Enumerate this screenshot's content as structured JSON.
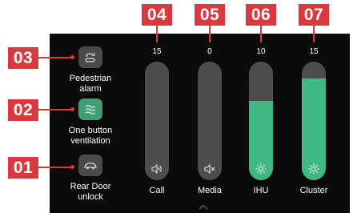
{
  "controls": [
    {
      "number": "03",
      "label_line1": "Pedestrian",
      "label_line2": "alarm",
      "icon": "pedestrian-alarm-icon",
      "active": false
    },
    {
      "number": "02",
      "label_line1": "One button",
      "label_line2": "ventilation",
      "icon": "ventilation-icon",
      "active": true
    },
    {
      "number": "01",
      "label_line1": "Rear Door",
      "label_line2": "unlock",
      "icon": "rear-door-car-icon",
      "active": false
    }
  ],
  "sliders": [
    {
      "number": "04",
      "value": "15",
      "label": "Call",
      "icon": "speaker-icon",
      "level": 0
    },
    {
      "number": "05",
      "value": "0",
      "label": "Media",
      "icon": "speaker-muted-icon",
      "level": 0
    },
    {
      "number": "06",
      "value": "10",
      "label": "IHU",
      "icon": "brightness-icon",
      "level": 0.67
    },
    {
      "number": "07",
      "value": "15",
      "label": "Cluster",
      "icon": "brightness-icon",
      "level": 0.86
    }
  ],
  "colors": {
    "callout": "#d93a3f",
    "accent": "#3fb884",
    "track": "#4d4d4d",
    "background": "#0b0b0b"
  },
  "footer_icon": "chevron-up-icon"
}
